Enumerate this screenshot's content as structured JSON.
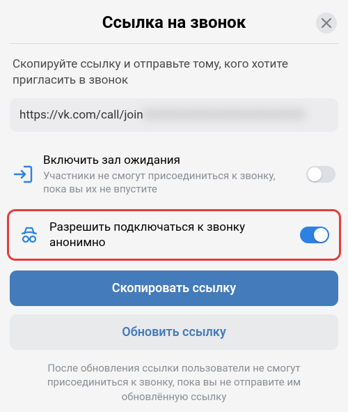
{
  "header": {
    "title": "Ссылка на звонок"
  },
  "instructions": "Скопируйте ссылку и отправьте тому, кого хотите пригласить в звонок",
  "link": {
    "visible": "https://vk.com/call/join",
    "hidden": "XXXXXXXXXXXXXXXXXXXX"
  },
  "options": {
    "waiting": {
      "title": "Включить зал ожидания",
      "sub": "Участники не смогут присоединиться к звонку, пока вы их не впустите",
      "enabled": false
    },
    "anonymous": {
      "title": "Разрешить подключаться к звонку анонимно",
      "enabled": true
    }
  },
  "buttons": {
    "copy": "Скопировать ссылку",
    "refresh": "Обновить ссылку"
  },
  "footer": "После обновления ссылки пользователи не смогут присоединиться к звонку, пока вы не отправите им обновлённую ссылку",
  "colors": {
    "accent": "#447bba",
    "toggle_on": "#2d81e0",
    "highlight": "#e63b3b"
  }
}
